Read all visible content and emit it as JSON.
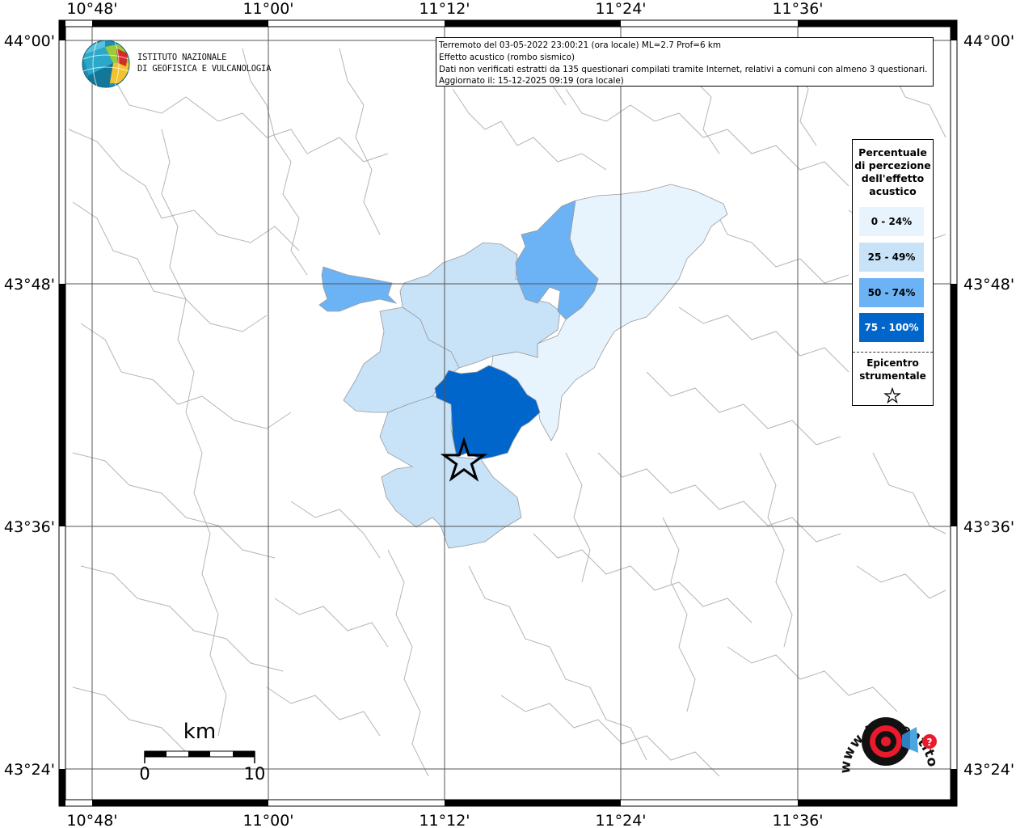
{
  "info": {
    "line1": "Terremoto del 03-05-2022 23:00:21 (ora locale) ML=2.7 Prof=6 km",
    "line2": "Effetto acustico (rombo sismico)",
    "line3": "Dati non verificati estratti da 135 questionari compilati tramite Internet, relativi a comuni con almeno 3 questionari.",
    "line4": "Aggiornato il: 15-12-2025 09:19 (ora locale)"
  },
  "axes": {
    "top": [
      "10°48'",
      "11°00'",
      "11°12'",
      "11°24'",
      "11°36'"
    ],
    "bottom": [
      "10°48'",
      "11°00'",
      "11°12'",
      "11°24'",
      "11°36'"
    ],
    "left": [
      "44°00'",
      "43°48'",
      "43°36'",
      "43°24'"
    ],
    "right": [
      "44°00'",
      "43°48'",
      "43°36'",
      "43°24'"
    ]
  },
  "legend": {
    "title_lines": [
      "Percentuale",
      "di percezione",
      "dell'effetto",
      "acustico"
    ],
    "items": [
      {
        "label": "0 - 24%",
        "color": "#e8f4fd"
      },
      {
        "label": "25 - 49%",
        "color": "#c8e2f8"
      },
      {
        "label": "50 - 74%",
        "color": "#6cb3f5"
      },
      {
        "label": "75 - 100%",
        "color": "#0066cc"
      }
    ],
    "epicenter_lines": [
      "Epicentro",
      "strumentale"
    ]
  },
  "scale": {
    "title": "km",
    "min": "0",
    "max": "10"
  },
  "logos": {
    "ingv_line1": "ISTITUTO NAZIONALE",
    "ingv_line2": "DI GEOFISICA E VULCANOLOGIA",
    "hsit_text": "www.haisentitoilterremoto.it"
  },
  "colors": {
    "boundary": "#b5b5b5",
    "grid": "#555555"
  }
}
